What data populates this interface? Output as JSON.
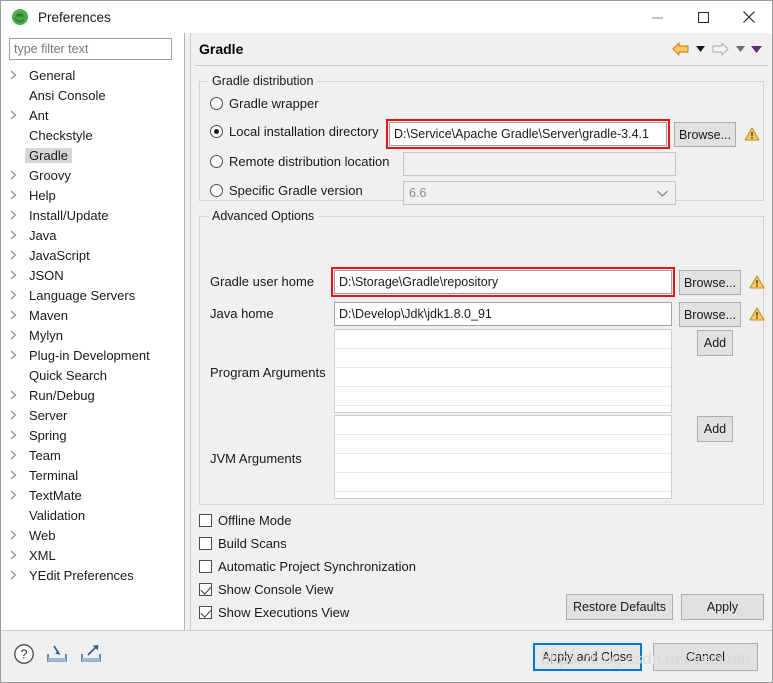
{
  "window": {
    "title": "Preferences",
    "icon": "eclipse-icon",
    "minimize_label": "Minimize",
    "maximize_label": "Maximize",
    "close_label": "Close"
  },
  "sidebar": {
    "filter_placeholder": "type filter text",
    "filter_value": "",
    "items": [
      {
        "label": "General",
        "expandable": true,
        "selected": false
      },
      {
        "label": "Ansi Console",
        "expandable": false,
        "selected": false
      },
      {
        "label": "Ant",
        "expandable": true,
        "selected": false
      },
      {
        "label": "Checkstyle",
        "expandable": false,
        "selected": false
      },
      {
        "label": "Gradle",
        "expandable": false,
        "selected": true
      },
      {
        "label": "Groovy",
        "expandable": true,
        "selected": false
      },
      {
        "label": "Help",
        "expandable": true,
        "selected": false
      },
      {
        "label": "Install/Update",
        "expandable": true,
        "selected": false
      },
      {
        "label": "Java",
        "expandable": true,
        "selected": false
      },
      {
        "label": "JavaScript",
        "expandable": true,
        "selected": false
      },
      {
        "label": "JSON",
        "expandable": true,
        "selected": false
      },
      {
        "label": "Language Servers",
        "expandable": true,
        "selected": false
      },
      {
        "label": "Maven",
        "expandable": true,
        "selected": false
      },
      {
        "label": "Mylyn",
        "expandable": true,
        "selected": false
      },
      {
        "label": "Plug-in Development",
        "expandable": true,
        "selected": false
      },
      {
        "label": "Quick Search",
        "expandable": false,
        "selected": false
      },
      {
        "label": "Run/Debug",
        "expandable": true,
        "selected": false
      },
      {
        "label": "Server",
        "expandable": true,
        "selected": false
      },
      {
        "label": "Spring",
        "expandable": true,
        "selected": false
      },
      {
        "label": "Team",
        "expandable": true,
        "selected": false
      },
      {
        "label": "Terminal",
        "expandable": true,
        "selected": false
      },
      {
        "label": "TextMate",
        "expandable": true,
        "selected": false
      },
      {
        "label": "Validation",
        "expandable": false,
        "selected": false
      },
      {
        "label": "Web",
        "expandable": true,
        "selected": false
      },
      {
        "label": "XML",
        "expandable": true,
        "selected": false
      },
      {
        "label": "YEdit Preferences",
        "expandable": true,
        "selected": false
      }
    ]
  },
  "page": {
    "title": "Gradle",
    "nav": {
      "back_icon": "back-arrow-icon",
      "back_menu_icon": "chevron-down-icon",
      "forward_icon": "forward-arrow-icon",
      "forward_menu_icon": "chevron-down-icon",
      "view_menu_icon": "chevron-down-icon"
    }
  },
  "gradle_distribution": {
    "legend": "Gradle distribution",
    "options": [
      {
        "label": "Gradle wrapper",
        "selected": false
      },
      {
        "label": "Local installation directory",
        "selected": true
      },
      {
        "label": "Remote distribution location",
        "selected": false
      },
      {
        "label": "Specific Gradle version",
        "selected": false
      }
    ],
    "local_install_value": "D:\\Service\\Apache Gradle\\Server\\gradle-3.4.1",
    "remote_location_value": "",
    "specific_version_value": "6.6",
    "browse_label": "Browse...",
    "warning_icon": "warning-triangle-icon"
  },
  "advanced_options": {
    "legend": "Advanced Options",
    "gradle_user_home_label": "Gradle user home",
    "gradle_user_home_value": "D:\\Storage\\Gradle\\repository",
    "java_home_label": "Java home",
    "java_home_value": "D:\\Develop\\Jdk\\jdk1.8.0_91",
    "program_arguments_label": "Program Arguments",
    "jvm_arguments_label": "JVM Arguments",
    "browse_label": "Browse...",
    "add_label": "Add",
    "warning_icon": "warning-triangle-icon",
    "program_arguments_rows": [
      "",
      "",
      "",
      ""
    ],
    "jvm_arguments_rows": [
      "",
      "",
      "",
      ""
    ]
  },
  "checkboxes": [
    {
      "label": "Offline Mode",
      "checked": false
    },
    {
      "label": "Build Scans",
      "checked": false
    },
    {
      "label": "Automatic Project Synchronization",
      "checked": false
    },
    {
      "label": "Show Console View",
      "checked": true
    },
    {
      "label": "Show Executions View",
      "checked": true
    }
  ],
  "page_buttons": {
    "restore_defaults": "Restore Defaults",
    "apply": "Apply"
  },
  "dialog_buttons": {
    "apply_and_close": "Apply and Close",
    "cancel": "Cancel"
  },
  "bottom_icons": {
    "help": "help-icon",
    "import": "import-icon",
    "export": "export-icon"
  },
  "watermark": "https://blog.csdn.net/securitit",
  "colors": {
    "highlight_red": "#ee1111",
    "focus_blue": "#0078d7",
    "selection_grey": "#d6d6d6",
    "warning_gold": "#e8a33d",
    "back_arrow": "#f0b429"
  }
}
